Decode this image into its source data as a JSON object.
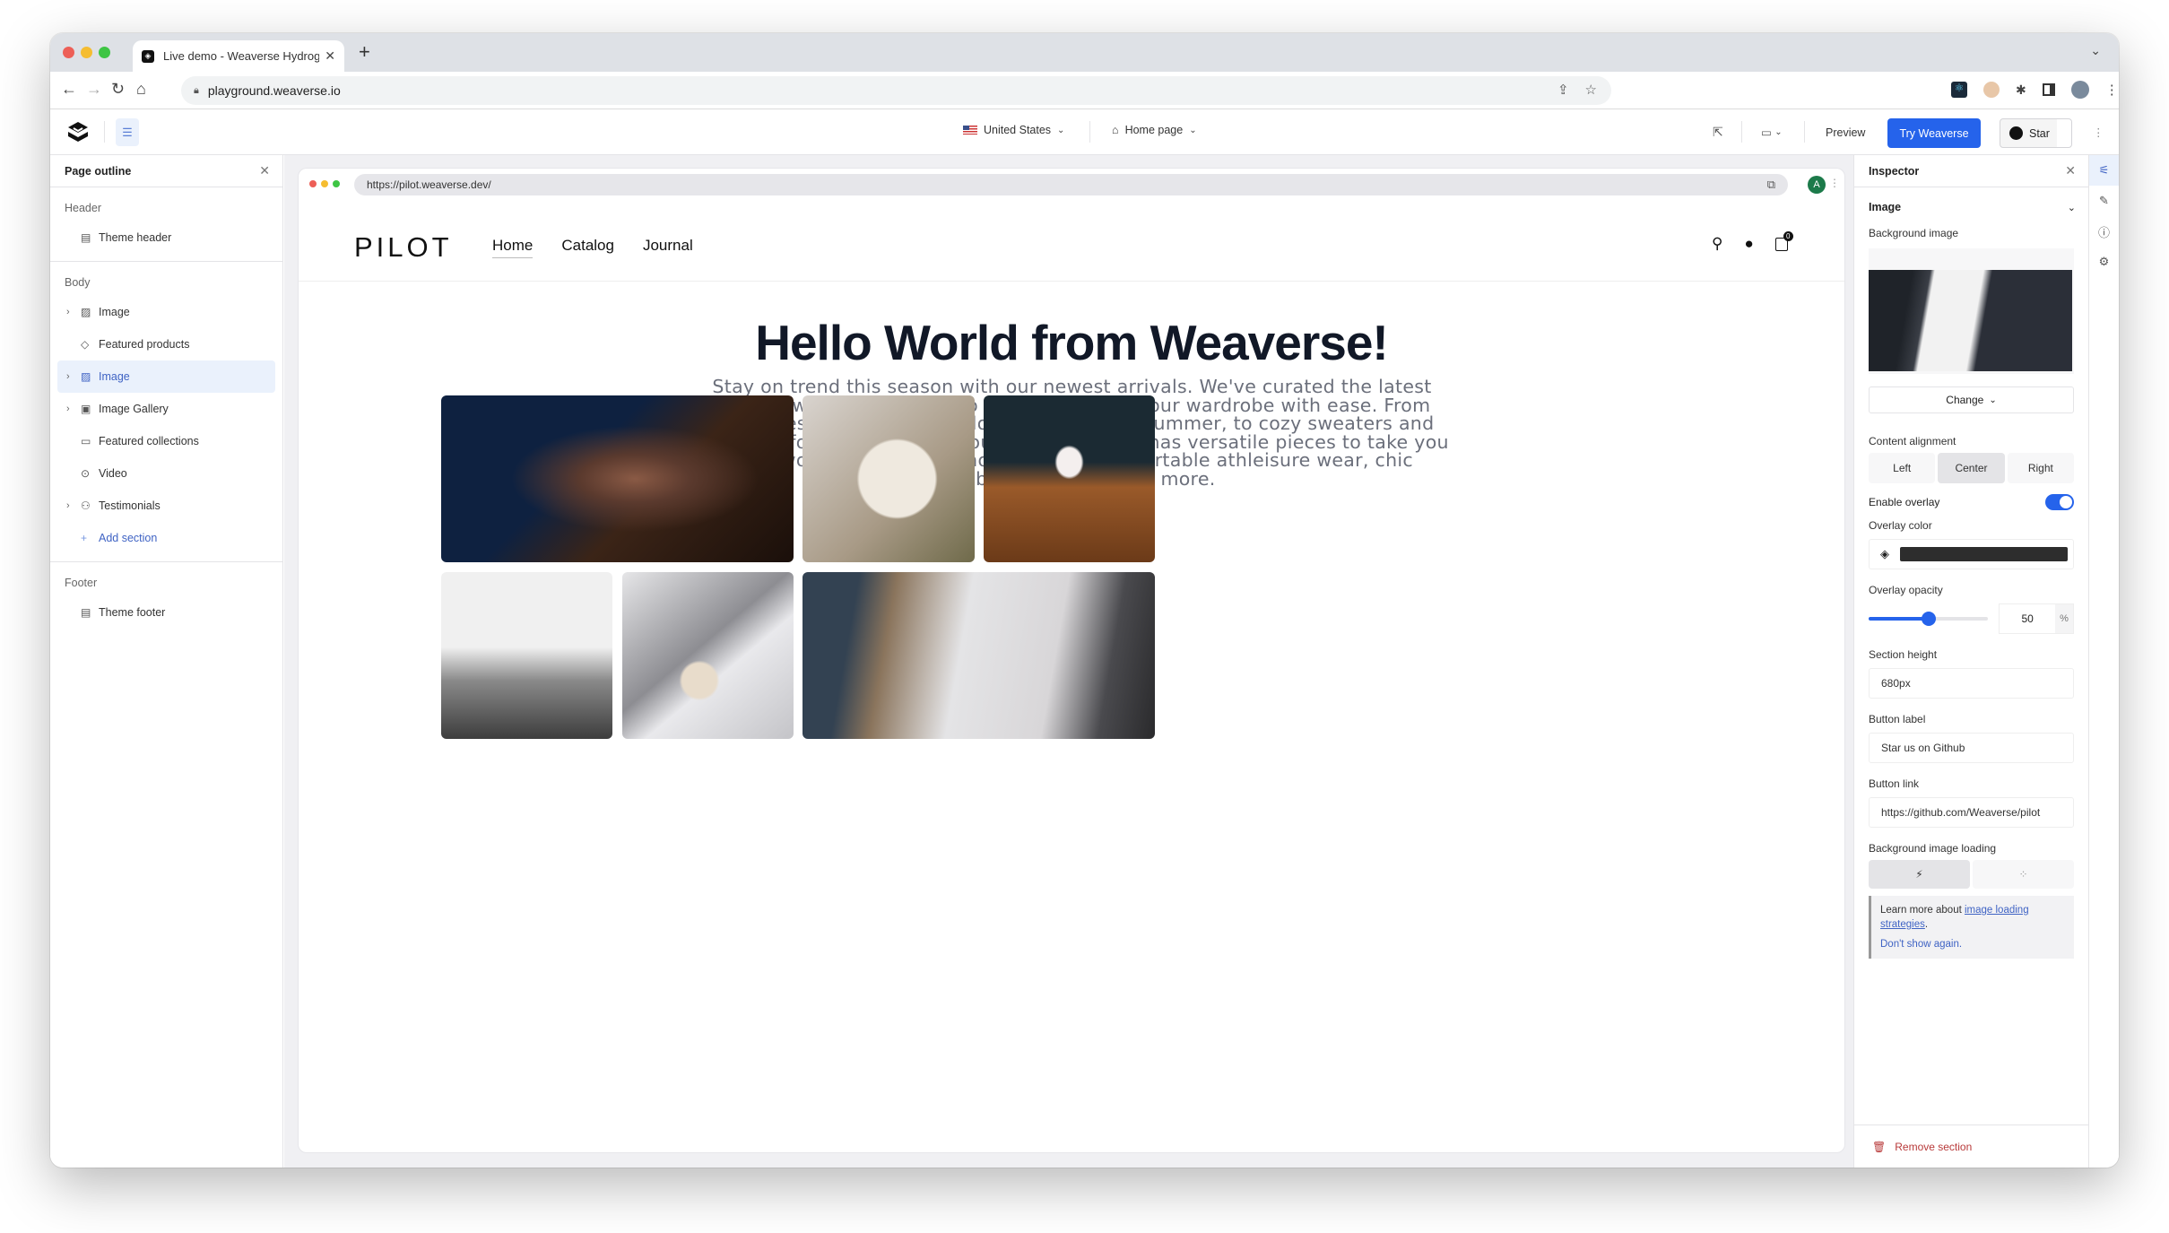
{
  "browser": {
    "tab_title": "Live demo - Weaverse Hydrog",
    "url": "playground.weaverse.io",
    "new_tab_icon": "plus-icon"
  },
  "toolbar": {
    "country": "United States",
    "page": "Home page",
    "preview_label": "Preview",
    "try_label": "Try Weaverse",
    "star_label": "Star"
  },
  "outline": {
    "title": "Page outline",
    "groups": [
      {
        "title": "Header",
        "items": [
          {
            "label": "Theme header",
            "icon": "layout-icon",
            "expandable": false
          }
        ]
      },
      {
        "title": "Body",
        "items": [
          {
            "label": "Image",
            "icon": "image-icon",
            "expandable": true
          },
          {
            "label": "Featured products",
            "icon": "tag-icon",
            "expandable": false
          },
          {
            "label": "Image",
            "icon": "image-icon",
            "expandable": true,
            "selected": true
          },
          {
            "label": "Image Gallery",
            "icon": "gallery-icon",
            "expandable": true
          },
          {
            "label": "Featured collections",
            "icon": "folder-icon",
            "expandable": false
          },
          {
            "label": "Video",
            "icon": "play-icon",
            "expandable": false
          },
          {
            "label": "Testimonials",
            "icon": "users-icon",
            "expandable": true
          }
        ],
        "add_label": "Add section"
      },
      {
        "title": "Footer",
        "items": [
          {
            "label": "Theme footer",
            "icon": "layout-icon",
            "expandable": false
          }
        ]
      }
    ]
  },
  "preview": {
    "url": "https://pilot.weaverse.dev/",
    "avatar_letter": "A",
    "brand": "PILOT",
    "nav": [
      "Home",
      "Catalog",
      "Journal"
    ],
    "cart_count": "0",
    "hero_title": "Hello World from Weaverse!",
    "hero_text": "Stay on trend this season with our newest arrivals. We've curated the latest looks in women's fashion so you can refresh your wardrobe with ease. From flowy dresses and printed blouses perfect for summer, to cozy sweaters and tall boots for cooler months, our new collection has versatile pieces to take you from work to weekend. Shop cute and comfortable athleisure wear, chic handbags, and so much more.",
    "gallery": [
      {
        "name": "piano-hand-image"
      },
      {
        "name": "book-flatlay-image"
      },
      {
        "name": "iced-coffee-image"
      },
      {
        "name": "bird-bw-image"
      },
      {
        "name": "earrings-image"
      },
      {
        "name": "laptop-flatlay-image"
      }
    ]
  },
  "inspector": {
    "title": "Inspector",
    "section": "Image",
    "background_image_label": "Background image",
    "change_label": "Change",
    "alignment_label": "Content alignment",
    "alignment_options": [
      "Left",
      "Center",
      "Right"
    ],
    "alignment_selected": "Center",
    "overlay_label": "Enable overlay",
    "overlay_enabled": true,
    "overlay_color_label": "Overlay color",
    "overlay_color": "#2d2d2d",
    "opacity_label": "Overlay opacity",
    "opacity_value": "50",
    "opacity_unit": "%",
    "height_label": "Section height",
    "height_value": "680px",
    "button_label_label": "Button label",
    "button_label_value": "Star us on Github",
    "button_link_label": "Button link",
    "button_link_value": "https://github.com/Weaverse/pilot",
    "loading_label": "Background image loading",
    "note_prefix": "Learn more about ",
    "note_link": "image loading strategies",
    "note_suffix": ".",
    "dont_show": "Don't show again.",
    "remove_label": "Remove section"
  },
  "colors": {
    "accent": "#2563eb",
    "danger": "#b83a3a",
    "selected_bg": "#eaf1fc"
  }
}
